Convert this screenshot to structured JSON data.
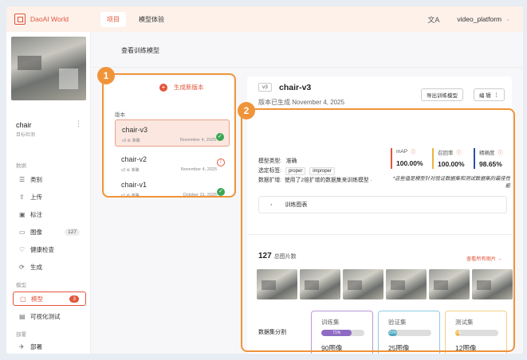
{
  "header": {
    "brand": "DaoAI World",
    "tabs": [
      "项目",
      "模型体验"
    ],
    "user": "video_platform"
  },
  "sidebar": {
    "project_name": "chair",
    "project_type": "目标检测",
    "sections": {
      "data": "数据",
      "model": "模型",
      "deploy": "部署"
    },
    "items": [
      {
        "label": "类别",
        "icon": "list-icon"
      },
      {
        "label": "上传",
        "icon": "upload-icon"
      },
      {
        "label": "标注",
        "icon": "annotate-icon"
      },
      {
        "label": "图像",
        "icon": "image-icon",
        "count": "127"
      },
      {
        "label": "健康检查",
        "icon": "heart-icon"
      },
      {
        "label": "生成",
        "icon": "generate-icon"
      },
      {
        "label": "模型",
        "icon": "folder-icon",
        "count": "3"
      },
      {
        "label": "可视化测试",
        "icon": "test-icon"
      },
      {
        "label": "部署",
        "icon": "deploy-icon"
      }
    ]
  },
  "main": {
    "view_title": "查看训练模型",
    "new_version": "生成新版本",
    "versions_label": "版本",
    "versions": [
      {
        "name": "chair-v3",
        "tag": "v3",
        "quality": "准确",
        "date": "November 4, 2025"
      },
      {
        "name": "chair-v2",
        "tag": "v2",
        "quality": "准确",
        "date": "November 4, 2025"
      },
      {
        "name": "chair-v1",
        "tag": "v1",
        "quality": "准确",
        "date": "October 31, 2025"
      }
    ],
    "callouts": [
      "1",
      "2"
    ]
  },
  "detail": {
    "tag": "v3",
    "name": "chair-v3",
    "generated": "版本已生成 November 4, 2025",
    "export_btn": "导出训练模型",
    "edit_btn": "编 辑",
    "model_type_k": "模型类型:",
    "model_type_v": "准确",
    "selected_tags_k": "选定标签:",
    "tags": [
      "proper",
      "improper"
    ],
    "augment_k": "数据扩增:",
    "augment_v": "使用了2倍扩增的数据集来训练模型 ·",
    "metrics": [
      {
        "label": "mAP",
        "value": "100.00%",
        "color": "#e2553c"
      },
      {
        "label": "召回率",
        "value": "100.00%",
        "color": "#e9b53a"
      },
      {
        "label": "精确度",
        "value": "98.65%",
        "color": "#2f4da8"
      }
    ],
    "note": "*这些值是模型针对验证数据集和测试数据集的最佳性能",
    "chart_toggle": "训练图表",
    "image_total": "127",
    "image_total_label": "总图片数",
    "view_all": "查看所有图片 →",
    "split_title": "数据集分割",
    "splits": [
      {
        "name": "训练集",
        "pct": "71%",
        "pct_value": 71,
        "count": "90图像",
        "color": "#8e6cc4"
      },
      {
        "name": "验证集",
        "pct": "20%",
        "pct_value": 20,
        "count": "25图像",
        "color": "#4aa7c0"
      },
      {
        "name": "测试集",
        "pct": "9%",
        "pct_value": 9,
        "count": "12图像",
        "color": "#f0b43a"
      }
    ]
  }
}
